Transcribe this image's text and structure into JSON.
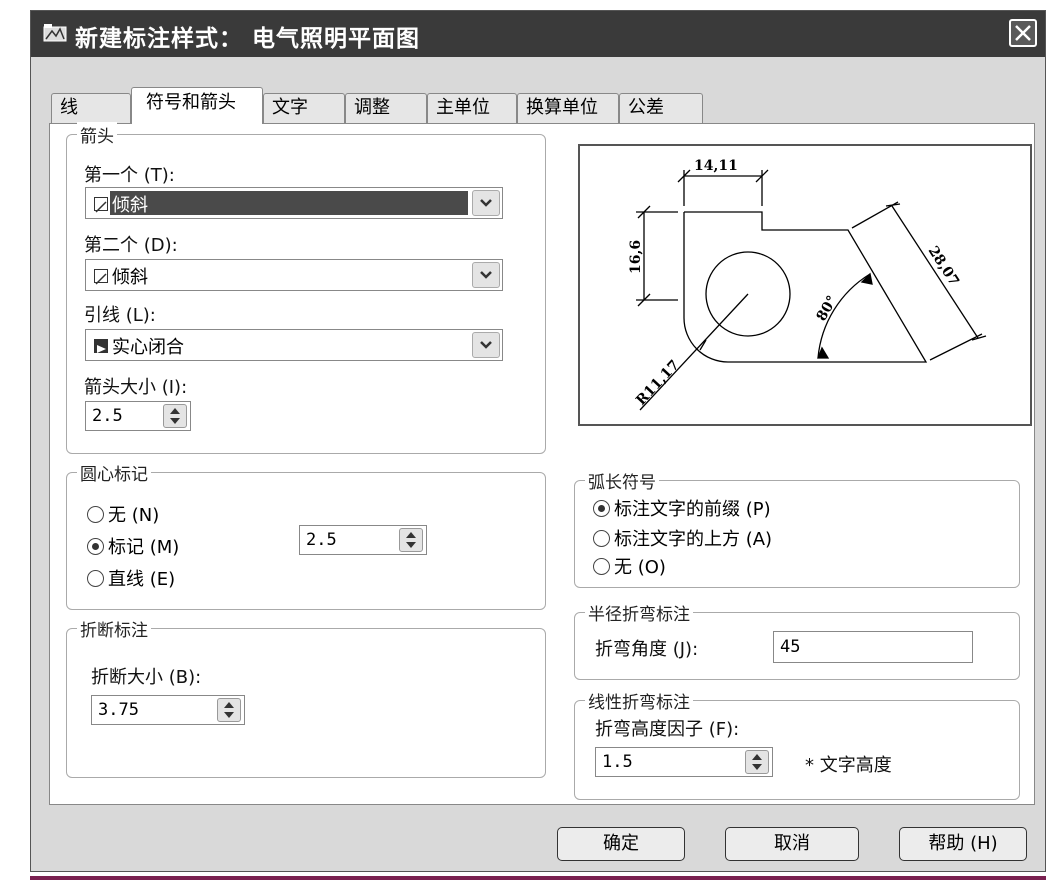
{
  "window": {
    "title": "新建标注样式： 电气照明平面图"
  },
  "tabs": [
    {
      "label": "线"
    },
    {
      "label": "符号和箭头"
    },
    {
      "label": "文字"
    },
    {
      "label": "调整"
    },
    {
      "label": "主单位"
    },
    {
      "label": "换算单位"
    },
    {
      "label": "公差"
    }
  ],
  "arrows": {
    "group_title": "箭头",
    "first_label": "第一个 (T):",
    "first_value": "倾斜",
    "second_label": "第二个 (D):",
    "second_value": "倾斜",
    "leader_label": "引线 (L):",
    "leader_value": "实心闭合",
    "size_label": "箭头大小 (I):",
    "size_value": "2.5"
  },
  "center_mark": {
    "group_title": "圆心标记",
    "opt_none": "无 (N)",
    "opt_mark": "标记 (M)",
    "opt_line": "直线 (E)",
    "size_value": "2.5"
  },
  "break": {
    "group_title": "折断标注",
    "size_label": "折断大小 (B):",
    "size_value": "3.75"
  },
  "preview": {
    "dim_top": "14,11",
    "dim_left": "16,6",
    "dim_diag": "28,07",
    "dim_angle": "80°",
    "dim_radius": "R11,17"
  },
  "arc_symbol": {
    "group_title": "弧长符号",
    "opt_prefix": "标注文字的前缀 (P)",
    "opt_above": "标注文字的上方 (A)",
    "opt_none": "无 (O)"
  },
  "radius_jog": {
    "group_title": "半径折弯标注",
    "angle_label": "折弯角度 (J):",
    "angle_value": "45"
  },
  "linear_jog": {
    "group_title": "线性折弯标注",
    "height_label": "折弯高度因子 (F):",
    "height_value": "1.5",
    "unit_label": "* 文字高度"
  },
  "buttons": {
    "ok": "确定",
    "cancel": "取消",
    "help": "帮助 (H)"
  }
}
